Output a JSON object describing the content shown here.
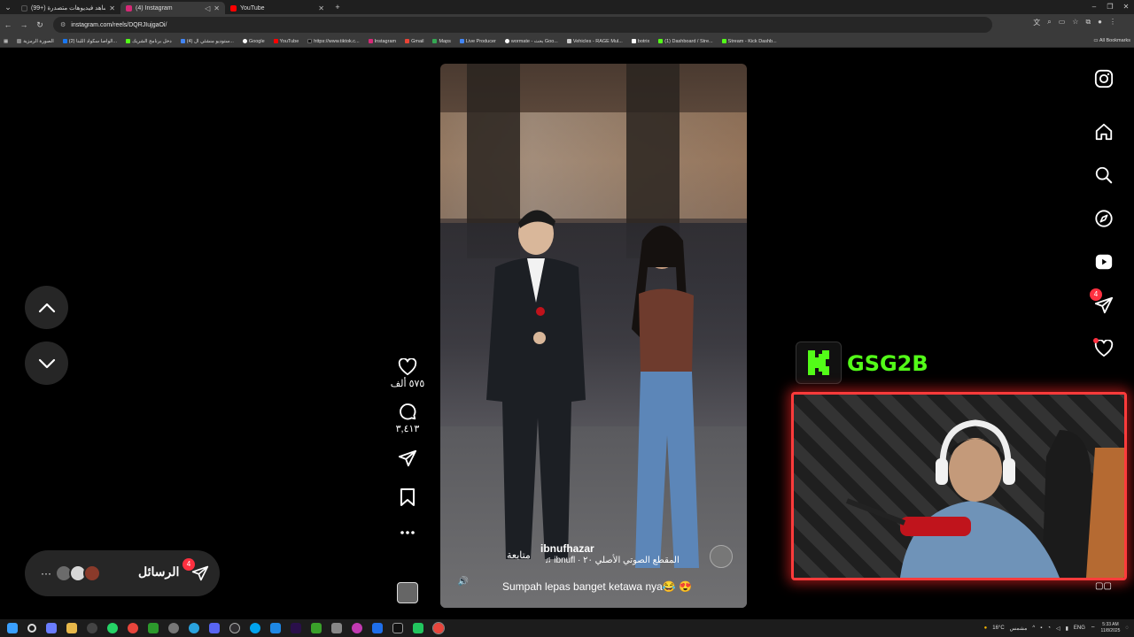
{
  "browser": {
    "tabs": [
      {
        "title": "(99+) شاهد فيديوهات متصدرة",
        "active": false,
        "favicon_color": "#222222"
      },
      {
        "title": "(4) Instagram",
        "active": true,
        "favicon_color": "#d62976"
      },
      {
        "title": "YouTube",
        "active": false,
        "favicon_color": "#ff0000"
      }
    ],
    "new_tab": "+",
    "url": "instagram.com/reels/DQRJIujgaOi/",
    "bookmarks": [
      {
        "label": "الصورة الرمزية",
        "color": "#888888"
      },
      {
        "label": "(2) الواصا سكواد اللبنا...",
        "color": "#1877f2"
      },
      {
        "label": "دخل برنامج الشريك",
        "color": "#53fc18"
      },
      {
        "label": "(4) ستوديو منشئي ال...",
        "color": "#4285f4"
      },
      {
        "label": "Google",
        "color": "#ffffff"
      },
      {
        "label": "YouTube",
        "color": "#ff0000"
      },
      {
        "label": "https://www.tiktok.c...",
        "color": "#111111"
      },
      {
        "label": "Instagram",
        "color": "#d62976"
      },
      {
        "label": "Gmail",
        "color": "#ea4335"
      },
      {
        "label": "Maps",
        "color": "#34a853"
      },
      {
        "label": "Live Producer",
        "color": "#4285f4"
      },
      {
        "label": "wormate - بحث Goo...",
        "color": "#ffffff"
      },
      {
        "label": "Vehicles - RAGE Mul...",
        "color": "#cccccc"
      },
      {
        "label": "botrix",
        "color": "#ffffff"
      },
      {
        "label": "(1) Dashboard / Stre...",
        "color": "#53fc18"
      },
      {
        "label": "Stream - Kick Dashb...",
        "color": "#53fc18"
      }
    ],
    "all_bookmarks": "All Bookmarks"
  },
  "reel": {
    "username": "ibnufhazar",
    "follow": "متابعة",
    "audio": "ibnufl · المقطع الصوتي الأصلي ٢٠",
    "caption": "Sumpah lepas banget ketawa nya😂 😍"
  },
  "actions": {
    "likes": "٥٧٥ ألف",
    "comments": "٣,٤١٣"
  },
  "messages": {
    "label": "الرسائل",
    "badge": "4"
  },
  "sidebar": {
    "badge": "4"
  },
  "stream": {
    "channel": "GSG2B",
    "brand_color": "#53fc18",
    "frame_color": "#ff3b3b"
  },
  "taskbar": {
    "weather": "16°C",
    "weather_desc": "مشمس",
    "lang": "ENG",
    "time": "5:33 AM",
    "date": "11/8/2025"
  }
}
